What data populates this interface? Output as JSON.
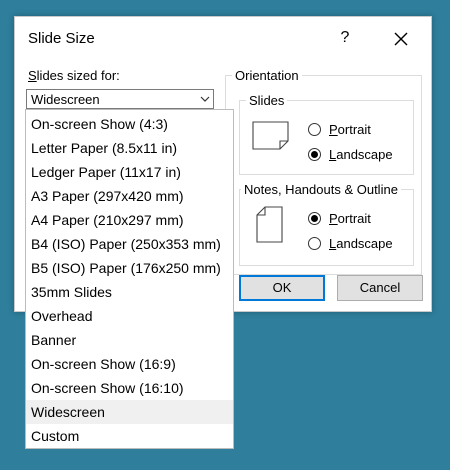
{
  "dialog": {
    "title": "Slide Size",
    "help_label": "?",
    "sized_for": {
      "mnemonic": "S",
      "rest": "lides sized for:"
    },
    "selected_size": "Widescreen",
    "orientation": {
      "legend": "Orientation",
      "slides": {
        "legend": "Slides",
        "portrait": {
          "mnemonic": "P",
          "rest": "ortrait",
          "checked": false
        },
        "landscape": {
          "mnemonic": "L",
          "rest": "andscape",
          "checked": true
        }
      },
      "notes": {
        "legend": "Notes, Handouts & Outline",
        "portrait": {
          "mnemonic": "P",
          "rest": "ortrait",
          "checked": true
        },
        "landscape": {
          "mnemonic": "L",
          "rest": "andscape",
          "checked": false
        }
      }
    },
    "ok_label": "OK",
    "cancel_label": "Cancel"
  },
  "dropdown": {
    "items": [
      "On-screen Show (4:3)",
      "Letter Paper (8.5x11 in)",
      "Ledger Paper (11x17 in)",
      "A3 Paper (297x420 mm)",
      "A4 Paper (210x297 mm)",
      "B4 (ISO) Paper (250x353 mm)",
      "B5 (ISO) Paper (176x250 mm)",
      "35mm Slides",
      "Overhead",
      "Banner",
      "On-screen Show (16:9)",
      "On-screen Show (16:10)",
      "Widescreen",
      "Custom"
    ],
    "selected": "Widescreen"
  },
  "colors": {
    "background": "#2e7e9c",
    "ok_border": "#0078d7",
    "hover_item": "#f0f0f0"
  },
  "icons": {
    "close": "close-icon",
    "dropdown": "chevron-down-icon",
    "slide_landscape": "landscape-page-icon",
    "slide_portrait": "portrait-page-icon"
  }
}
